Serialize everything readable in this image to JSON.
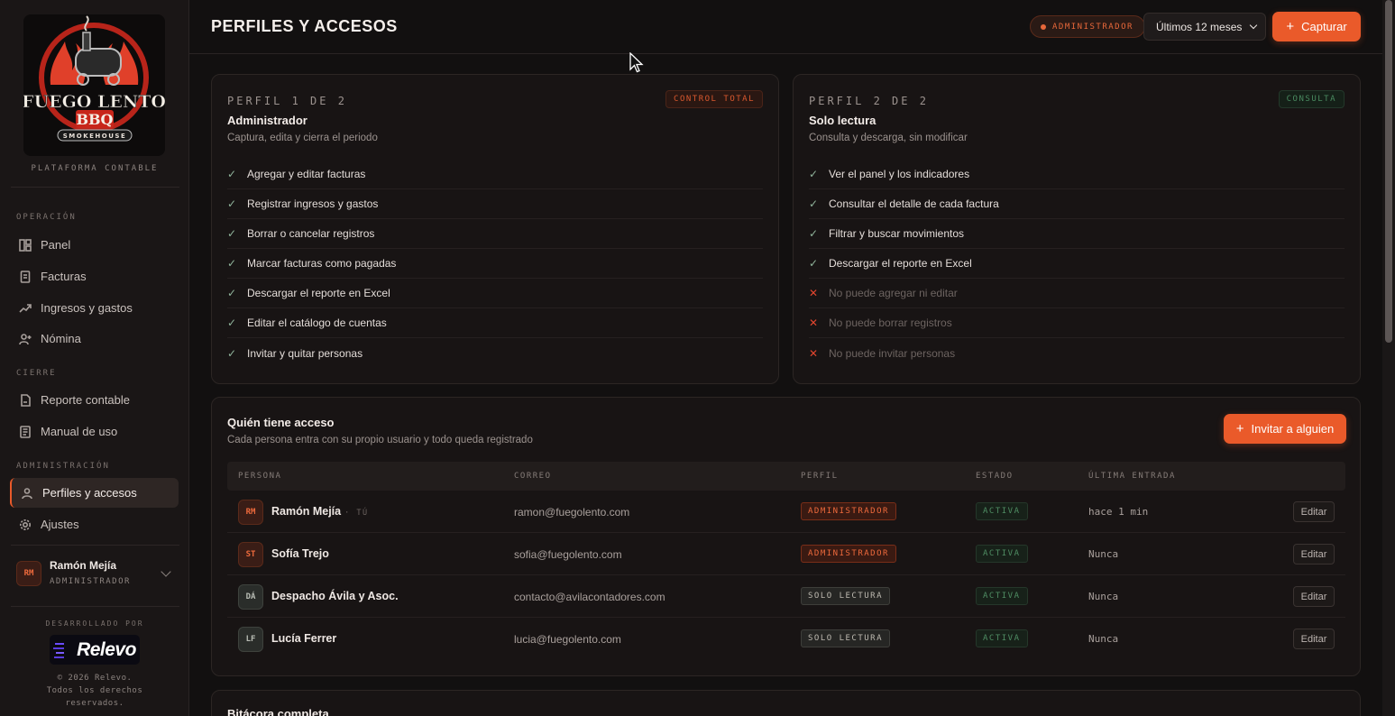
{
  "brand": {
    "logo_line1": "FUEGO LENTO",
    "logo_line2": "BBQ",
    "logo_line3": "SMOKEHOUSE",
    "platform": "PLATAFORMA CONTABLE",
    "accent": "#ea5a2a"
  },
  "sidebar": {
    "sections": [
      {
        "label": "OPERACIÓN",
        "items": [
          {
            "label": "Panel",
            "icon": "dashboard-icon"
          },
          {
            "label": "Facturas",
            "icon": "invoice-icon"
          },
          {
            "label": "Ingresos y gastos",
            "icon": "trend-icon"
          },
          {
            "label": "Nómina",
            "icon": "user-plus-icon"
          }
        ]
      },
      {
        "label": "CIERRE",
        "items": [
          {
            "label": "Reporte contable",
            "icon": "report-icon"
          },
          {
            "label": "Manual de uso",
            "icon": "manual-icon"
          }
        ]
      },
      {
        "label": "ADMINISTRACIÓN",
        "items": [
          {
            "label": "Perfiles y accesos",
            "icon": "users-icon",
            "active": true
          },
          {
            "label": "Ajustes",
            "icon": "gear-icon"
          }
        ]
      }
    ],
    "user": {
      "initials": "RM",
      "name": "Ramón Mejía",
      "role": "ADMINISTRADOR"
    },
    "dev_by": "DESARROLLADO POR",
    "dev_logo": "Relevo",
    "copyright_lines": [
      "© 2026 Relevo.",
      "Todos los derechos",
      "reservados."
    ]
  },
  "header": {
    "title": "PERFILES Y ACCESOS",
    "role_chip": "ADMINISTRADOR",
    "period": "Últimos 12 meses",
    "capture_label": "Capturar"
  },
  "profiles": [
    {
      "eyebrow": "PERFIL 1 DE 2",
      "tag": "CONTROL TOTAL",
      "title": "Administrador",
      "subtitle": "Captura, edita y cierra el periodo",
      "permissions": [
        {
          "text": "Agregar y editar facturas",
          "allowed": true
        },
        {
          "text": "Registrar ingresos y gastos",
          "allowed": true
        },
        {
          "text": "Borrar o cancelar registros",
          "allowed": true
        },
        {
          "text": "Marcar facturas como pagadas",
          "allowed": true
        },
        {
          "text": "Descargar el reporte en Excel",
          "allowed": true
        },
        {
          "text": "Editar el catálogo de cuentas",
          "allowed": true
        },
        {
          "text": "Invitar y quitar personas",
          "allowed": true
        }
      ]
    },
    {
      "eyebrow": "PERFIL 2 DE 2",
      "tag": "CONSULTA",
      "title": "Solo lectura",
      "subtitle": "Consulta y descarga, sin modificar",
      "permissions": [
        {
          "text": "Ver el panel y los indicadores",
          "allowed": true
        },
        {
          "text": "Consultar el detalle de cada factura",
          "allowed": true
        },
        {
          "text": "Filtrar y buscar movimientos",
          "allowed": true
        },
        {
          "text": "Descargar el reporte en Excel",
          "allowed": true
        },
        {
          "text": "No puede agregar ni editar",
          "allowed": false
        },
        {
          "text": "No puede borrar registros",
          "allowed": false
        },
        {
          "text": "No puede invitar personas",
          "allowed": false
        }
      ]
    }
  ],
  "access": {
    "title": "Quién tiene acceso",
    "subtitle": "Cada persona entra con su propio usuario y todo queda registrado",
    "invite_label": "Invitar a alguien",
    "columns": [
      "PERSONA",
      "CORREO",
      "PERFIL",
      "ESTADO",
      "ÚLTIMA ENTRADA"
    ],
    "you_marker": "· TÚ",
    "edit_label": "Editar",
    "rows": [
      {
        "initials": "RM",
        "name": "Ramón Mejía",
        "you": true,
        "email": "ramon@fuegolento.com",
        "profile": "ADMINISTRADOR",
        "profile_kind": "admin",
        "status": "ACTIVA",
        "last": "hace 1 min"
      },
      {
        "initials": "ST",
        "name": "Sofía Trejo",
        "you": false,
        "email": "sofia@fuegolento.com",
        "profile": "ADMINISTRADOR",
        "profile_kind": "admin",
        "status": "ACTIVA",
        "last": "Nunca"
      },
      {
        "initials": "DÁ",
        "name": "Despacho Ávila y Asoc.",
        "you": false,
        "email": "contacto@avilacontadores.com",
        "profile": "SOLO LECTURA",
        "profile_kind": "read",
        "status": "ACTIVA",
        "last": "Nunca"
      },
      {
        "initials": "LF",
        "name": "Lucía Ferrer",
        "you": false,
        "email": "lucia@fuegolento.com",
        "profile": "SOLO LECTURA",
        "profile_kind": "read",
        "status": "ACTIVA",
        "last": "Nunca"
      }
    ]
  },
  "log": {
    "title": "Bitácora completa"
  }
}
